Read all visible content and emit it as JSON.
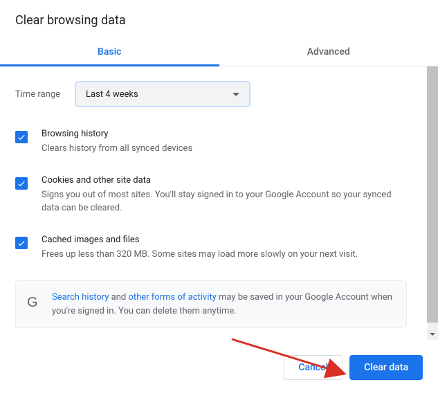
{
  "dialog": {
    "title": "Clear browsing data",
    "tabs": {
      "basic": "Basic",
      "advanced": "Advanced"
    },
    "time": {
      "label": "Time range",
      "value": "Last 4 weeks"
    },
    "items": [
      {
        "title": "Browsing history",
        "desc": "Clears history from all synced devices"
      },
      {
        "title": "Cookies and other site data",
        "desc": "Signs you out of most sites. You'll stay signed in to your Google Account so your synced data can be cleared."
      },
      {
        "title": "Cached images and files",
        "desc": "Frees up less than 320 MB. Some sites may load more slowly on your next visit."
      }
    ],
    "info": {
      "link1": "Search history",
      "mid1": " and ",
      "link2": "other forms of activity",
      "mid2": " may be saved in your Google Account when you're signed in. You can delete them anytime."
    },
    "buttons": {
      "cancel": "Cancel",
      "clear": "Clear data"
    }
  }
}
